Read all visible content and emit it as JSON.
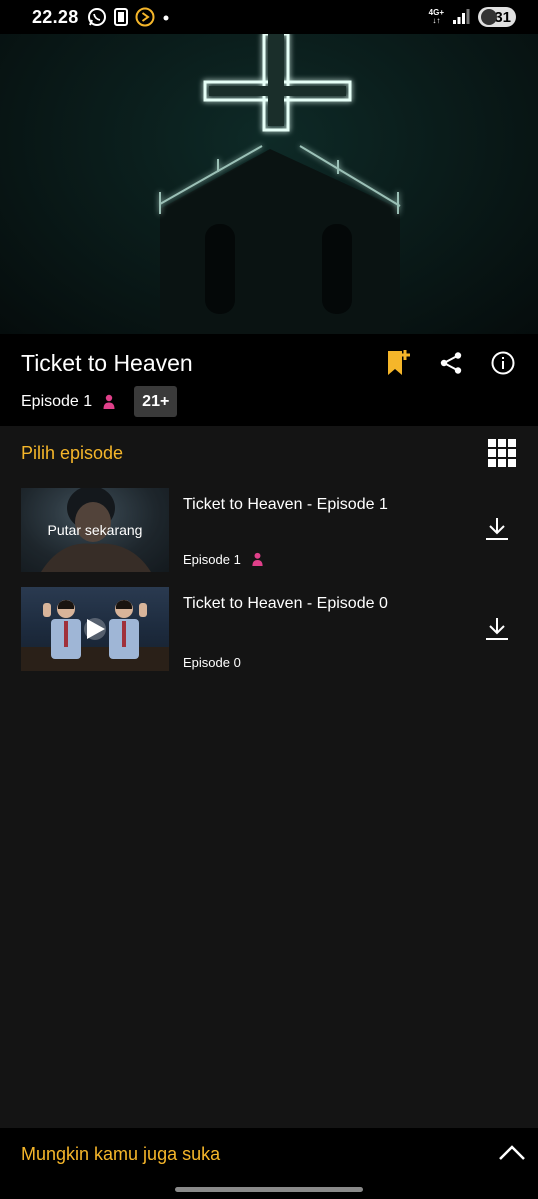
{
  "status_bar": {
    "time": "22.28",
    "network": "4G+",
    "battery": "31"
  },
  "show": {
    "title": "Ticket to Heaven",
    "episode_label": "Episode 1",
    "rating": "21+"
  },
  "episodes_section": {
    "title": "Pilih episode",
    "items": [
      {
        "title": "Ticket to Heaven - Episode 1",
        "meta": "Episode 1",
        "overlay": "Putar sekarang"
      },
      {
        "title": "Ticket to Heaven - Episode 0",
        "meta": "Episode 0"
      }
    ]
  },
  "recommendations": {
    "title": "Mungkin kamu juga suka"
  },
  "colors": {
    "accent": "#f5b62a",
    "kids_icon": "#e0408a",
    "background": "#141414"
  }
}
